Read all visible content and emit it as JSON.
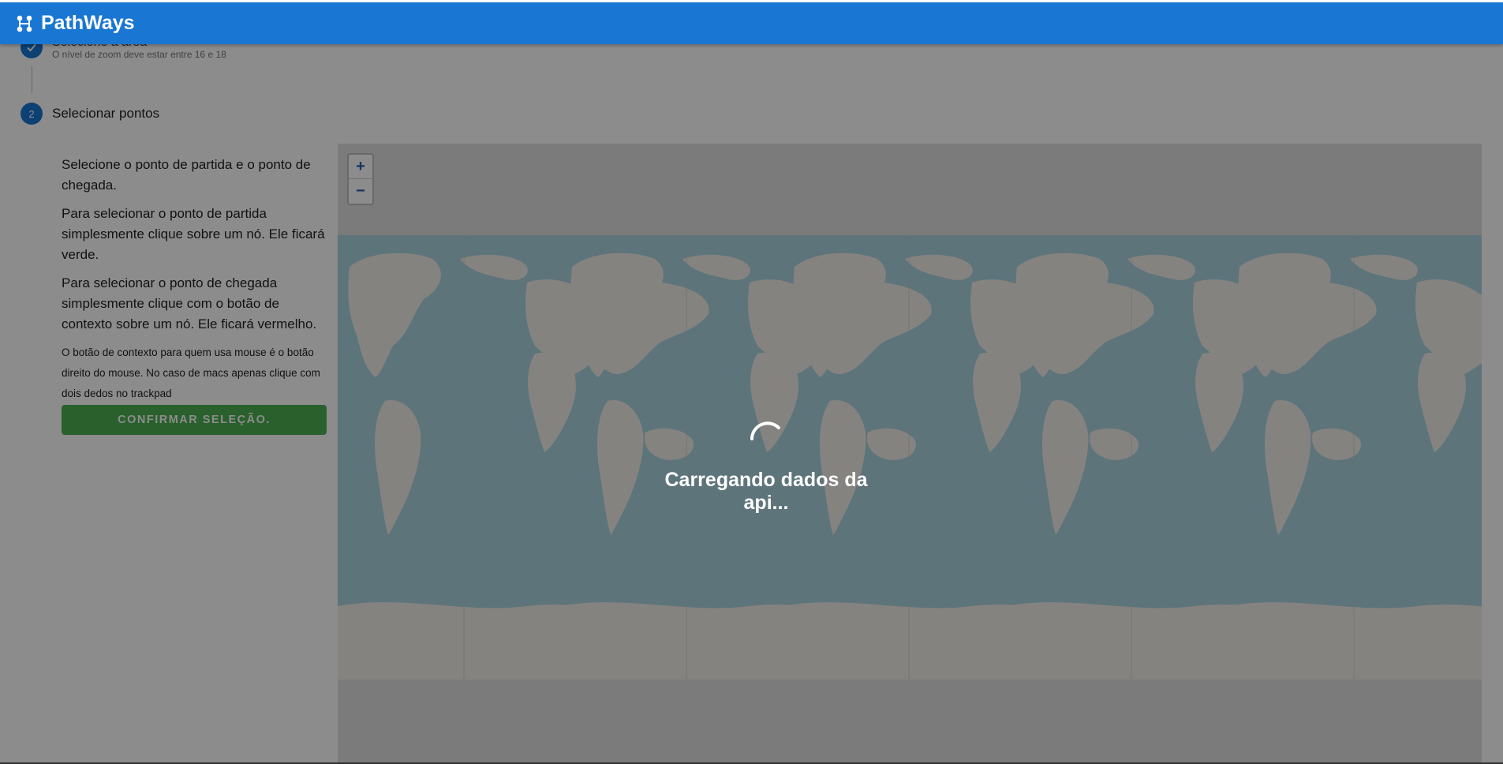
{
  "app": {
    "title": "PathWays"
  },
  "stepper": {
    "step1": {
      "label": "Selecione a área",
      "subtitle": "O nível de zoom deve estar entre 16 e 18"
    },
    "step2": {
      "number": "2",
      "label": "Selecionar pontos"
    }
  },
  "sidebar": {
    "p1": "Selecione o ponto de partida e o ponto de chegada.",
    "p2": "Para selecionar o ponto de partida simplesmente clique sobre um nó. Ele ficará verde.",
    "p3": "Para selecionar o ponto de chegada simplesmente clique com o botão de contexto sobre um nó. Ele ficará vermelho.",
    "note": "O botão de contexto para quem usa mouse é o botão direito do mouse. No caso de macs apenas clique com dois dedos no trackpad",
    "confirm_label": "CONFIRMAR SELEÇÃO."
  },
  "map": {
    "zoom_in": "+",
    "zoom_out": "−"
  },
  "loading": {
    "text": "Carregando dados da api..."
  },
  "colors": {
    "primary": "#1976d2",
    "success": "#4caf50",
    "water": "#aad3df",
    "land": "#f2efe9"
  }
}
